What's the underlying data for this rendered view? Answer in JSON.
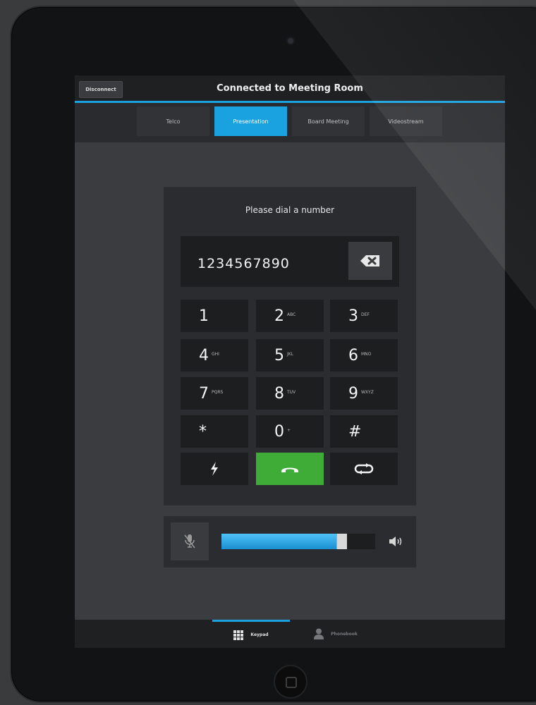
{
  "topbar": {
    "title": "Connected to Meeting Room",
    "disconnect_label": "Disconnect"
  },
  "tabs": [
    {
      "label": "Telco",
      "active": false
    },
    {
      "label": "Presentation",
      "active": true
    },
    {
      "label": "Board Meeting",
      "active": false
    },
    {
      "label": "Videostream",
      "active": false
    }
  ],
  "dialer": {
    "prompt": "Please dial a number",
    "number": "1234567890",
    "keys": [
      {
        "digit": "1",
        "letters": ""
      },
      {
        "digit": "2",
        "letters": "ABC"
      },
      {
        "digit": "3",
        "letters": "DEF"
      },
      {
        "digit": "4",
        "letters": "GHI"
      },
      {
        "digit": "5",
        "letters": "JKL"
      },
      {
        "digit": "6",
        "letters": "MNO"
      },
      {
        "digit": "7",
        "letters": "PQRS"
      },
      {
        "digit": "8",
        "letters": "TUV"
      },
      {
        "digit": "9",
        "letters": "WXYZ"
      },
      {
        "digit": "*",
        "letters": ""
      },
      {
        "digit": "0",
        "letters": "+"
      },
      {
        "digit": "#",
        "letters": ""
      }
    ]
  },
  "volume": {
    "level": 0.8
  },
  "colors": {
    "accent": "#19a1e0",
    "call": "#3eac36"
  },
  "icons": {
    "backspace": "backspace-icon",
    "flash": "flash-icon",
    "call": "call-icon",
    "redial": "redial-icon",
    "mute": "mic-muted-icon",
    "speaker": "speaker-icon",
    "keypad": "keypad-icon",
    "phonebook": "person-icon"
  },
  "bottom_tabs": [
    {
      "label": "Keypad",
      "active": true
    },
    {
      "label": "Phonebook",
      "active": false
    }
  ]
}
